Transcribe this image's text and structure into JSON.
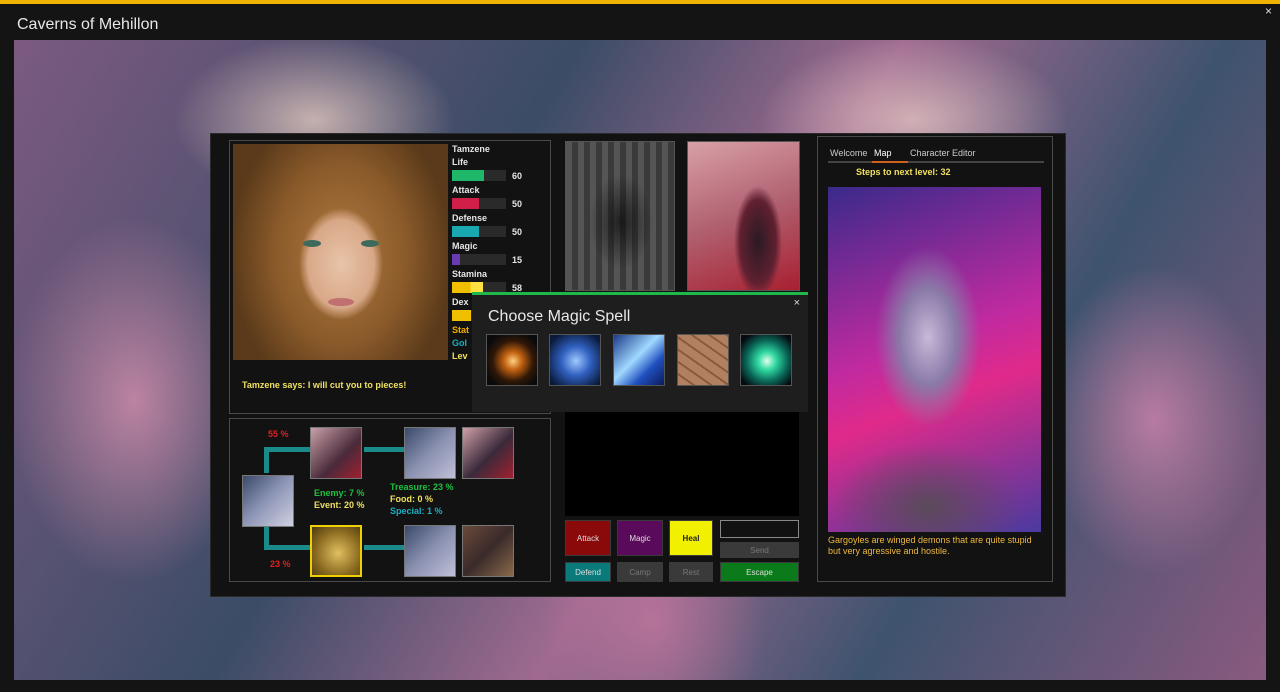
{
  "window": {
    "title": "Caverns of Mehillon",
    "close_glyph": "×"
  },
  "character": {
    "name": "Tamzene",
    "stats": [
      {
        "label": "Life",
        "value": "60",
        "level": 0.6,
        "color": "#1fb86a"
      },
      {
        "label": "Attack",
        "value": "50",
        "level": 0.5,
        "color": "#d0204a"
      },
      {
        "label": "Defense",
        "value": "50",
        "level": 0.5,
        "color": "#1aa8b0"
      },
      {
        "label": "Magic",
        "value": "15",
        "level": 0.15,
        "color": "#6a3ab0"
      },
      {
        "label": "Stamina",
        "value": "58",
        "level": 0.58,
        "color": "#f0c000",
        "secondary_color": "#ffe040"
      },
      {
        "label": "Dex",
        "value": "",
        "level": 0.35,
        "color": "#f0c000"
      }
    ],
    "extra_lines": [
      {
        "label": "Stat",
        "color": "#f0b000"
      },
      {
        "label": "Gol",
        "color": "#1ab0c0"
      },
      {
        "label": "Lev",
        "color": "#f0e060"
      }
    ],
    "speech": "Tamzene says: I will cut you to pieces!"
  },
  "map": {
    "percent_top": "55 %",
    "percent_bottom": "23 %",
    "enemy": "Enemy: 7 %",
    "event": "Event: 20 %",
    "treasure": "Treasure: 23 %",
    "food": "Food: 0 %",
    "special": "Special: 1 %"
  },
  "actions": {
    "attack": "Attack",
    "magic": "Magic",
    "heal": "Heal",
    "send": "Send",
    "defend": "Defend",
    "camp": "Camp",
    "rest": "Rest",
    "escape": "Escape",
    "input_value": ""
  },
  "sidebar": {
    "tabs": [
      "Welcome",
      "Map",
      "Character Editor"
    ],
    "active_tab": "Map",
    "steps": "Steps to next level: 32",
    "description": "Gargoyles are winged demons that are quite stupid but very agressive and hostile."
  },
  "dialog": {
    "title": "Choose Magic Spell",
    "close_glyph": "×",
    "spells": [
      "fire-spell-icon",
      "frost-spell-icon",
      "lightning-spell-icon",
      "earth-spell-icon",
      "vortex-spell-icon"
    ]
  },
  "colors": {
    "accent_top": "#f0b400",
    "dialog_accent": "#1fb84a",
    "attack_button": "#8a0a0a",
    "magic_button": "#5a0a5a",
    "heal_button": "#f0f000",
    "defend_button": "#0a7a7a",
    "escape_button": "#0a7a1a",
    "disabled_button": "#3a3a3a"
  }
}
